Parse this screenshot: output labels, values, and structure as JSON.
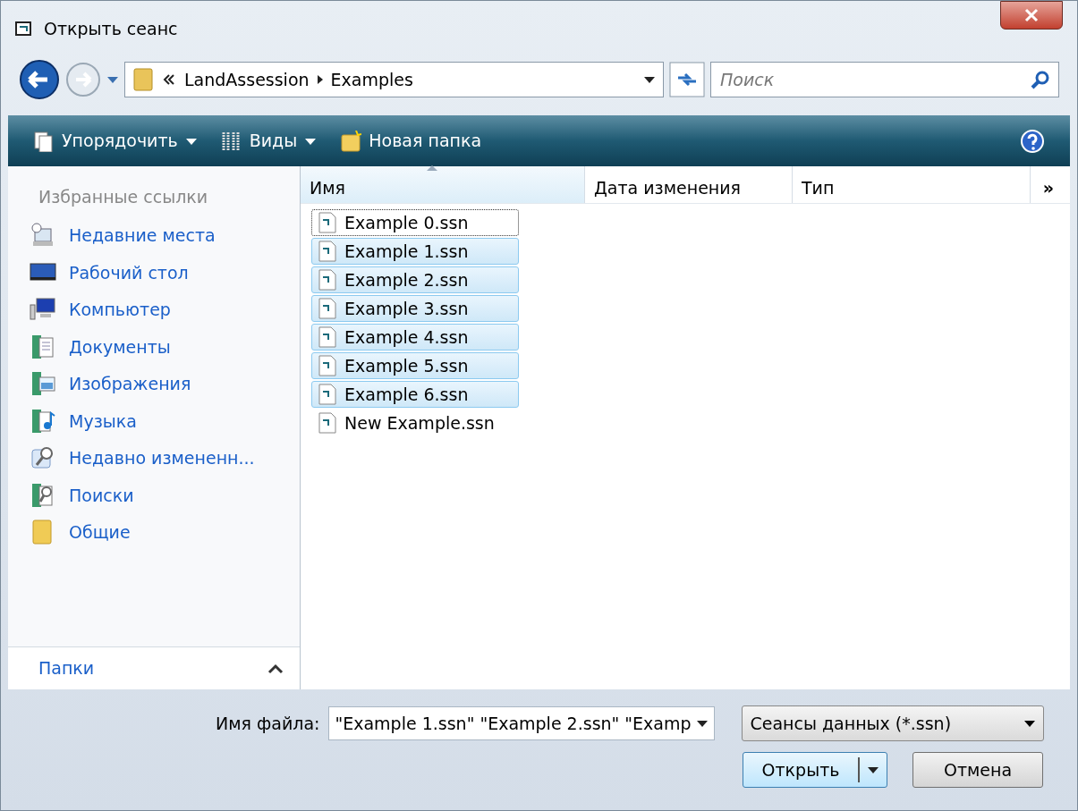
{
  "window": {
    "title": "Открыть сеанс"
  },
  "address": {
    "path": [
      {
        "label": "LandAssession"
      },
      {
        "label": "Examples"
      }
    ]
  },
  "search": {
    "placeholder": "Поиск"
  },
  "toolbar": [
    {
      "label": "Упорядочить",
      "kind": "organize"
    },
    {
      "label": "Виды",
      "kind": "views"
    },
    {
      "label": "Новая папка",
      "kind": "newfolder"
    }
  ],
  "sidebar": {
    "heading": "Избранные ссылки",
    "items": [
      {
        "label": "Недавние места",
        "kind": "recent"
      },
      {
        "label": "Рабочий стол",
        "kind": "desktop"
      },
      {
        "label": "Компьютер",
        "kind": "computer"
      },
      {
        "label": "Документы",
        "kind": "documents"
      },
      {
        "label": "Изображения",
        "kind": "pictures"
      },
      {
        "label": "Музыка",
        "kind": "music"
      },
      {
        "label": "Недавно измененн...",
        "kind": "changed"
      },
      {
        "label": "Поиски",
        "kind": "searches"
      },
      {
        "label": "Общие",
        "kind": "folder"
      }
    ],
    "folders": {
      "label": "Папки",
      "expanded": false
    }
  },
  "table": {
    "columns": [
      {
        "label": "Имя",
        "sorted": true
      },
      {
        "label": "Дата изменения",
        "sorted": false
      },
      {
        "label": "Тип",
        "sorted": false
      }
    ],
    "overflow": "»",
    "rows": [
      {
        "name": "Example 0.ssn",
        "selected": false,
        "focused": true
      },
      {
        "name": "Example 1.ssn",
        "selected": true,
        "focused": false
      },
      {
        "name": "Example 2.ssn",
        "selected": true,
        "focused": false
      },
      {
        "name": "Example 3.ssn",
        "selected": true,
        "focused": false
      },
      {
        "name": "Example 4.ssn",
        "selected": true,
        "focused": false
      },
      {
        "name": "Example 5.ssn",
        "selected": true,
        "focused": false
      },
      {
        "name": "Example 6.ssn",
        "selected": true,
        "focused": false
      },
      {
        "name": "New Example.ssn",
        "selected": false,
        "focused": false
      }
    ]
  },
  "footer": {
    "filename_label": "Имя файла:",
    "filename_value": "\"Example 1.ssn\" \"Example 2.ssn\" \"Examp",
    "filter": "Сеансы данных (*.ssn)",
    "open": "Открыть",
    "cancel": "Отмена"
  }
}
